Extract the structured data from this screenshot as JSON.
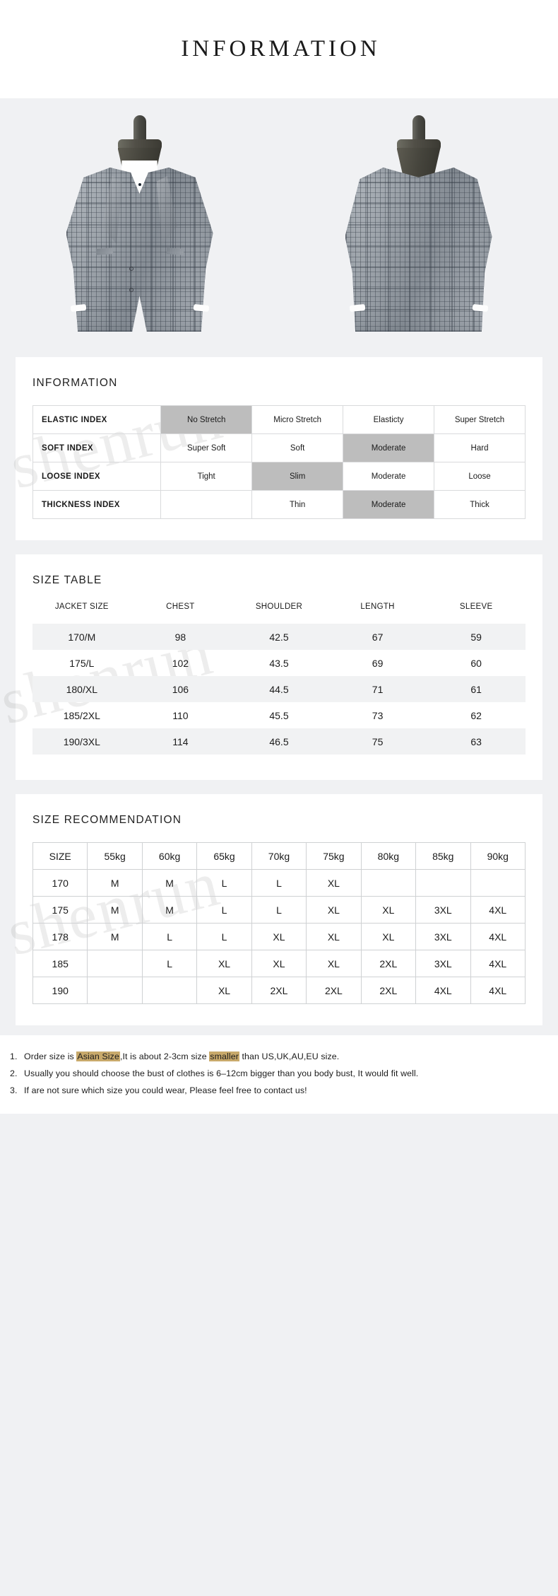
{
  "header": {
    "title": "INFORMATION"
  },
  "product_images": {
    "front": {
      "alt": "grey plaid blazer front view on mannequin"
    },
    "back": {
      "alt": "grey plaid blazer back view on mannequin"
    }
  },
  "watermark": {
    "text": "shenrun"
  },
  "information": {
    "title": "INFORMATION",
    "rows": [
      {
        "label": "ELASTIC  INDEX",
        "cells": [
          "No Stretch",
          "Micro Stretch",
          "Elasticty",
          "Super Stretch"
        ],
        "highlight": [
          true,
          false,
          false,
          false
        ]
      },
      {
        "label": "SOFT  INDEX",
        "cells": [
          "Super Soft",
          "Soft",
          "Moderate",
          "Hard"
        ],
        "highlight": [
          false,
          false,
          true,
          false
        ]
      },
      {
        "label": "LOOSE  INDEX",
        "cells": [
          "Tight",
          "Slim",
          "Moderate",
          "Loose"
        ],
        "highlight": [
          false,
          true,
          false,
          false
        ]
      },
      {
        "label": "THICKNESS  INDEX",
        "cells": [
          "",
          "Thin",
          "Moderate",
          "Thick"
        ],
        "highlight": [
          false,
          false,
          true,
          false
        ]
      }
    ]
  },
  "size_table": {
    "title": "SIZE  TABLE",
    "columns": [
      "JACKET SIZE",
      "CHEST",
      "SHOULDER",
      "LENGTH",
      "SLEEVE"
    ],
    "rows": [
      [
        "170/M",
        "98",
        "42.5",
        "67",
        "59"
      ],
      [
        "175/L",
        "102",
        "43.5",
        "69",
        "60"
      ],
      [
        "180/XL",
        "106",
        "44.5",
        "71",
        "61"
      ],
      [
        "185/2XL",
        "110",
        "45.5",
        "73",
        "62"
      ],
      [
        "190/3XL",
        "114",
        "46.5",
        "75",
        "63"
      ]
    ]
  },
  "size_recommendation": {
    "title": "SIZE RECOMMENDATION",
    "columns": [
      "SIZE",
      "55kg",
      "60kg",
      "65kg",
      "70kg",
      "75kg",
      "80kg",
      "85kg",
      "90kg"
    ],
    "rows": [
      [
        "170",
        "M",
        "M",
        "L",
        "L",
        "XL",
        "",
        "",
        ""
      ],
      [
        "175",
        "M",
        "M",
        "L",
        "L",
        "XL",
        "XL",
        "3XL",
        "4XL"
      ],
      [
        "178",
        "M",
        "L",
        "L",
        "XL",
        "XL",
        "XL",
        "3XL",
        "4XL"
      ],
      [
        "185",
        "",
        "L",
        "XL",
        "XL",
        "XL",
        "2XL",
        "3XL",
        "4XL"
      ],
      [
        "190",
        "",
        "",
        "XL",
        "2XL",
        "2XL",
        "2XL",
        "4XL",
        "4XL"
      ]
    ]
  },
  "notes": [
    {
      "num": "1.",
      "parts": [
        {
          "t": "Order  size  is  ",
          "hl": false
        },
        {
          "t": "Asian Size",
          "hl": true
        },
        {
          "t": ",It is about 2-3cm size ",
          "hl": false
        },
        {
          "t": "smaller",
          "hl": true
        },
        {
          "t": " than US,UK,AU,EU size.",
          "hl": false
        }
      ]
    },
    {
      "num": "2.",
      "parts": [
        {
          "t": "Usually  you  should  choose  the  bust  of  clothes  is  6–12cm  bigger  than  you  body bust, It would fit well.",
          "hl": false
        }
      ]
    },
    {
      "num": "3.",
      "parts": [
        {
          "t": "If  are  not  sure  which  size  you  could  wear, Please feel free to contact us!",
          "hl": false
        }
      ]
    }
  ],
  "colors": {
    "page_bg": "#f0f1f3",
    "card_bg": "#ffffff",
    "highlight_cell": "#bdbdbd",
    "alt_row": "#f1f2f3",
    "note_highlight": "#c8a96b",
    "text": "#1b1b1b"
  }
}
